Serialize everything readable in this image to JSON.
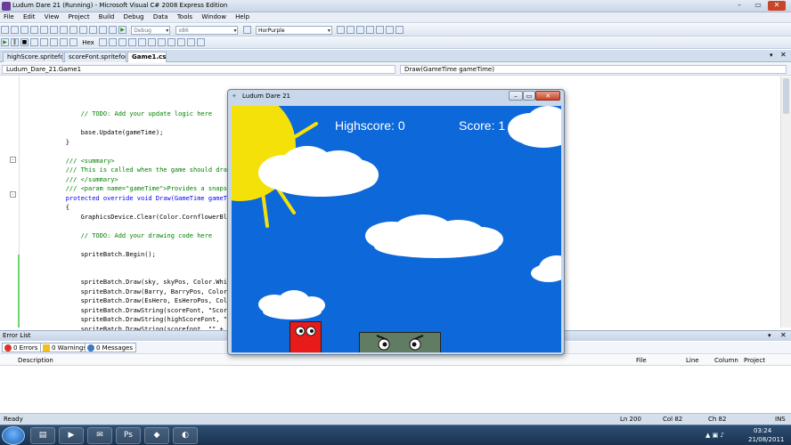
{
  "window": {
    "title": "Ludum Dare 21 (Running) - Microsoft Visual C# 2008 Express Edition"
  },
  "menu": [
    "File",
    "Edit",
    "View",
    "Project",
    "Build",
    "Debug",
    "Data",
    "Tools",
    "Window",
    "Help"
  ],
  "toolbar": {
    "config": "Debug",
    "platform": "x86",
    "search_target": "HorPurple",
    "hex_label": "Hex"
  },
  "tabs": [
    "highScore.spritefont",
    "scoreFont.spritefont",
    "Game1.cs*"
  ],
  "nav": {
    "class": "Ludum_Dare_21.Game1",
    "member": "Draw(GameTime gameTime)"
  },
  "code": [
    {
      "t": "            // TODO: Add your update logic here",
      "c": "#008000"
    },
    {
      "t": "",
      "c": "#000"
    },
    {
      "t": "            base.Update(gameTime);",
      "c": "#000"
    },
    {
      "t": "        }",
      "c": "#000"
    },
    {
      "t": "",
      "c": "#000"
    },
    {
      "t": "        /// <summary>",
      "c": "#008000"
    },
    {
      "t": "        /// This is called when the game should dra",
      "c": "#008000"
    },
    {
      "t": "        /// </summary>",
      "c": "#008000"
    },
    {
      "t": "        /// <param name=\"gameTime\">Provides a snaps",
      "c": "#008000"
    },
    {
      "t": "        protected override void Draw(GameTime gameT",
      "c": "#0000ff"
    },
    {
      "t": "        {",
      "c": "#000"
    },
    {
      "t": "            GraphicsDevice.Clear(Color.CornflowerBl",
      "c": "#000"
    },
    {
      "t": "",
      "c": "#000"
    },
    {
      "t": "            // TODO: Add your drawing code here",
      "c": "#008000"
    },
    {
      "t": "",
      "c": "#000"
    },
    {
      "t": "            spriteBatch.Begin();",
      "c": "#000"
    },
    {
      "t": "",
      "c": "#000"
    },
    {
      "t": "",
      "c": "#000"
    },
    {
      "t": "            spriteBatch.Draw(sky, skyPos, Color.Whi",
      "c": "#000"
    },
    {
      "t": "            spriteBatch.Draw(Barry, BarryPos, Color",
      "c": "#000"
    },
    {
      "t": "            spriteBatch.Draw(EsHero, EsHeroPos, Col",
      "c": "#000"
    },
    {
      "t": "            spriteBatch.DrawString(scoreFont, \"Scor",
      "c": "#000"
    },
    {
      "t": "            spriteBatch.DrawString(highScoreFont, \"",
      "c": "#000"
    },
    {
      "t": "            spriteBatch.DrawString(scorefont, \"\" +",
      "c": "#000"
    }
  ],
  "game": {
    "title": "Ludum Dare 21",
    "highscore_label": "Highscore:",
    "highscore": "0",
    "score_label": "Score:",
    "score": "1",
    "sky_color": "#0d68d9"
  },
  "error_list": {
    "title": "Error List",
    "errors": "0 Errors",
    "warnings": "0 Warnings",
    "messages": "0 Messages",
    "columns": [
      "Description",
      "File",
      "Line",
      "Column",
      "Project"
    ]
  },
  "status": {
    "text": "Ready",
    "ln": "Ln 200",
    "col": "Col 82",
    "ch": "Ch 82",
    "mode": "INS"
  },
  "taskbar": {
    "time": "03:24",
    "date": "21/08/2011"
  }
}
